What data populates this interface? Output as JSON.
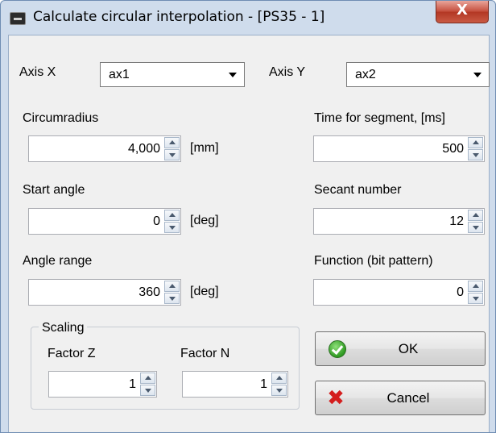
{
  "window": {
    "title": "Calculate circular interpolation - [PS35 - 1]",
    "close_glyph": "X"
  },
  "axis_x": {
    "label": "Axis X",
    "value": "ax1"
  },
  "axis_y": {
    "label": "Axis Y",
    "value": "ax2"
  },
  "circumradius": {
    "label": "Circumradius",
    "value": "4,000",
    "unit": "[mm]"
  },
  "start_angle": {
    "label": "Start angle",
    "value": "0",
    "unit": "[deg]"
  },
  "angle_range": {
    "label": "Angle range",
    "value": "360",
    "unit": "[deg]"
  },
  "time_for_segment": {
    "label": "Time for segment, [ms]",
    "value": "500"
  },
  "secant_number": {
    "label": "Secant number",
    "value": "12"
  },
  "function_bits": {
    "label": "Function (bit pattern)",
    "value": "0"
  },
  "scaling": {
    "title": "Scaling",
    "factor_z": {
      "label": "Factor Z",
      "value": "1"
    },
    "factor_n": {
      "label": "Factor N",
      "value": "1"
    }
  },
  "buttons": {
    "ok": "OK",
    "cancel": "Cancel"
  },
  "icons": {
    "app": "app-icon",
    "close": "close-icon",
    "ok": "check-circle-icon",
    "cancel": "red-x-icon",
    "dropdown": "chevron-down-icon",
    "spin_up": "spin-up-icon",
    "spin_down": "spin-down-icon"
  },
  "colors": {
    "close_button": "#c6503f",
    "ok_icon": "#2f9a22",
    "cancel_icon": "#d41e1e",
    "frame": "#cfdcec"
  }
}
